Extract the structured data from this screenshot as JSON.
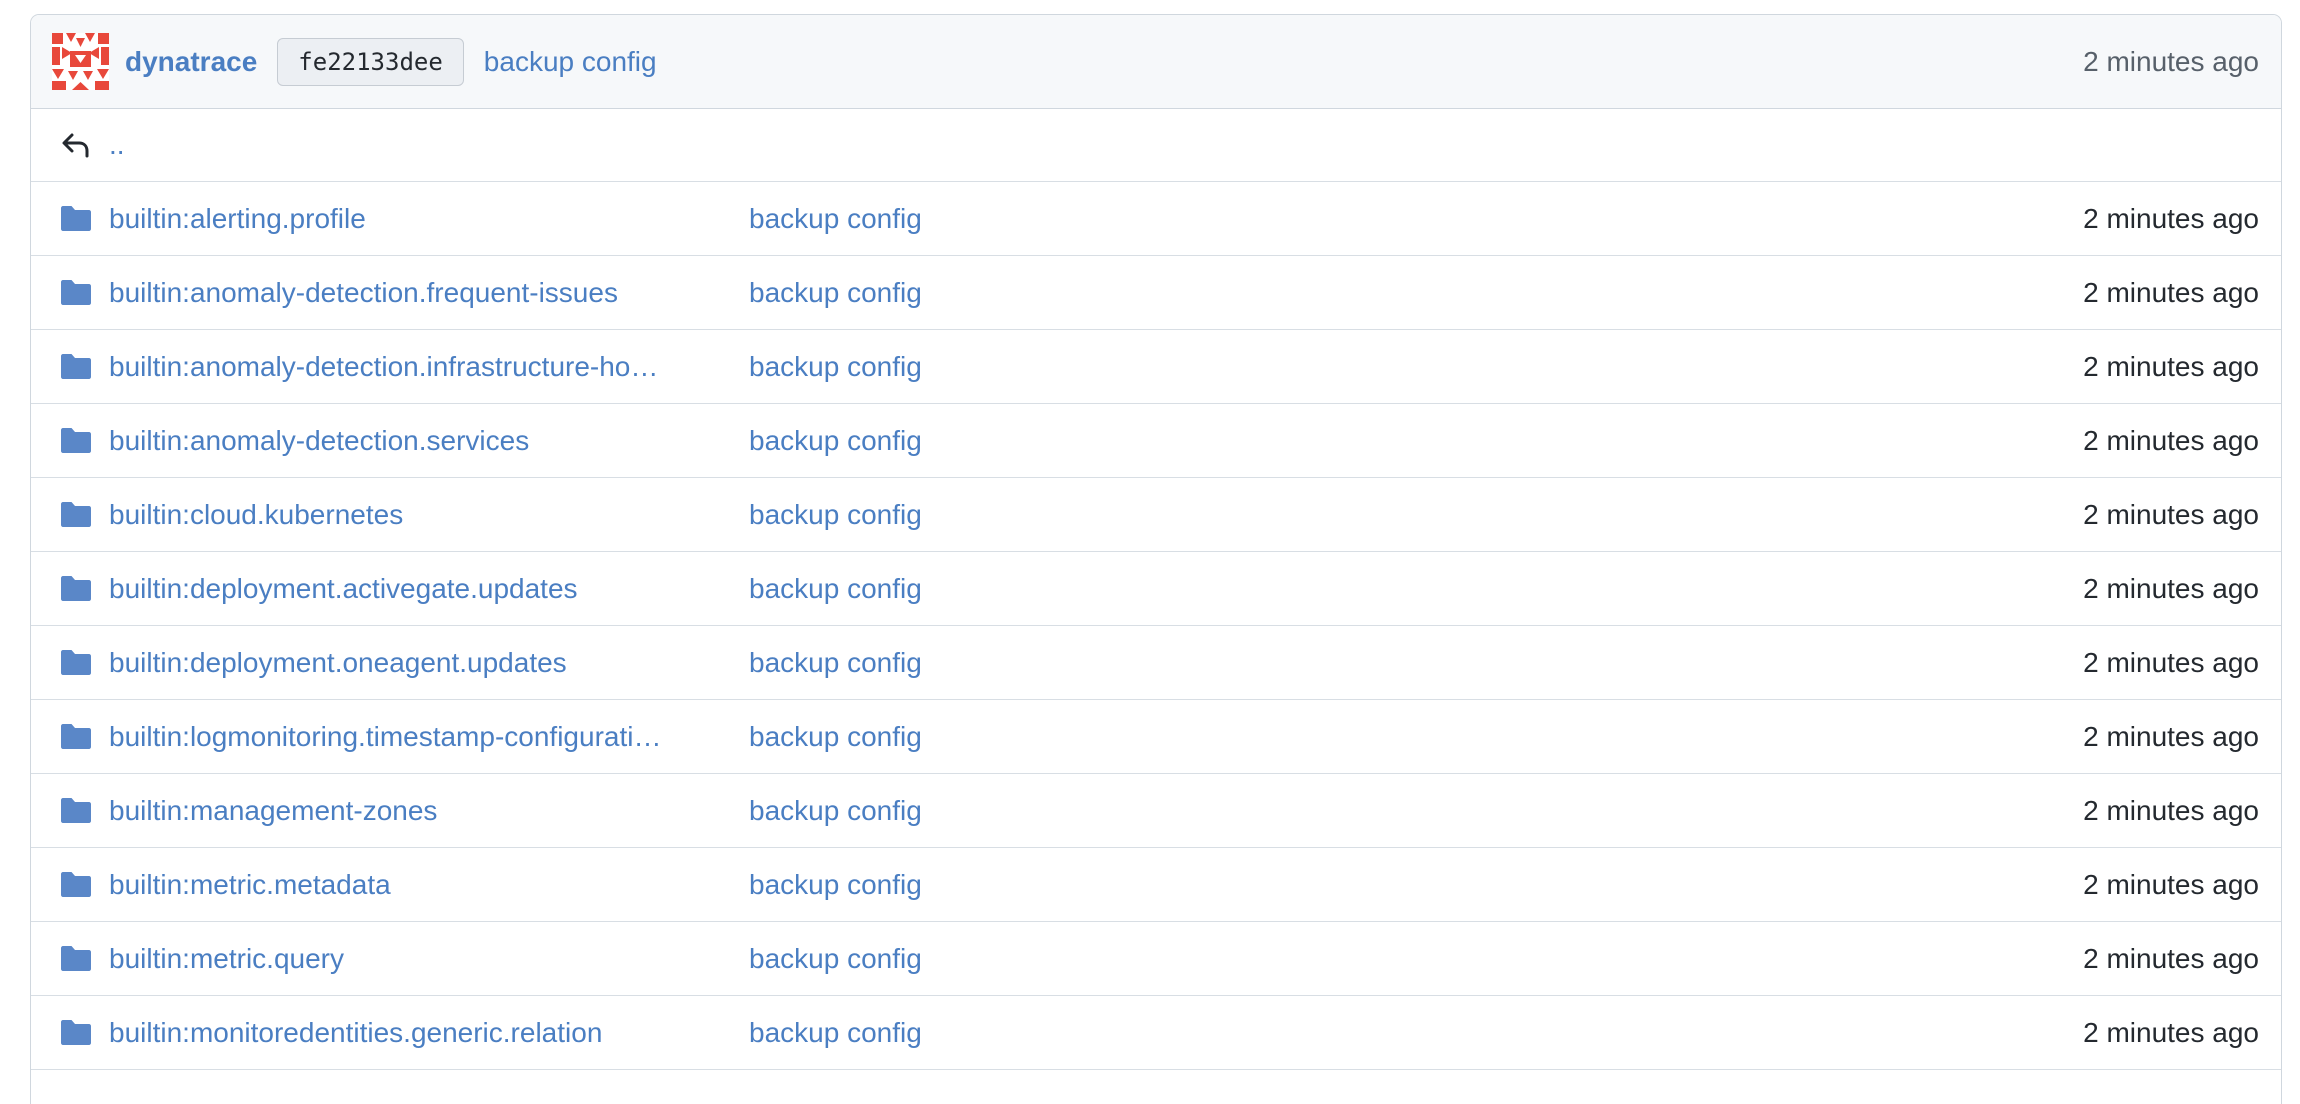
{
  "commit": {
    "author": "dynatrace",
    "sha": "fe22133dee",
    "message": "backup config",
    "time": "2 minutes ago"
  },
  "parent": {
    "label": ".."
  },
  "icons": {
    "folder": "folder-icon",
    "up": "reply-arrow-icon",
    "avatar": "dynatrace-avatar",
    "folder_color": "#5a87c8",
    "link_color": "#4a7ec2",
    "avatar_color": "#e8483b"
  },
  "files": [
    {
      "name": "builtin:alerting.profile",
      "message": "backup config",
      "time": "2 minutes ago"
    },
    {
      "name": "builtin:anomaly-detection.frequent-issues",
      "message": "backup config",
      "time": "2 minutes ago"
    },
    {
      "name": "builtin:anomaly-detection.infrastructure-ho…",
      "message": "backup config",
      "time": "2 minutes ago"
    },
    {
      "name": "builtin:anomaly-detection.services",
      "message": "backup config",
      "time": "2 minutes ago"
    },
    {
      "name": "builtin:cloud.kubernetes",
      "message": "backup config",
      "time": "2 minutes ago"
    },
    {
      "name": "builtin:deployment.activegate.updates",
      "message": "backup config",
      "time": "2 minutes ago"
    },
    {
      "name": "builtin:deployment.oneagent.updates",
      "message": "backup config",
      "time": "2 minutes ago"
    },
    {
      "name": "builtin:logmonitoring.timestamp-configurati…",
      "message": "backup config",
      "time": "2 minutes ago"
    },
    {
      "name": "builtin:management-zones",
      "message": "backup config",
      "time": "2 minutes ago"
    },
    {
      "name": "builtin:metric.metadata",
      "message": "backup config",
      "time": "2 minutes ago"
    },
    {
      "name": "builtin:metric.query",
      "message": "backup config",
      "time": "2 minutes ago"
    },
    {
      "name": "builtin:monitoredentities.generic.relation",
      "message": "backup config",
      "time": "2 minutes ago"
    }
  ]
}
